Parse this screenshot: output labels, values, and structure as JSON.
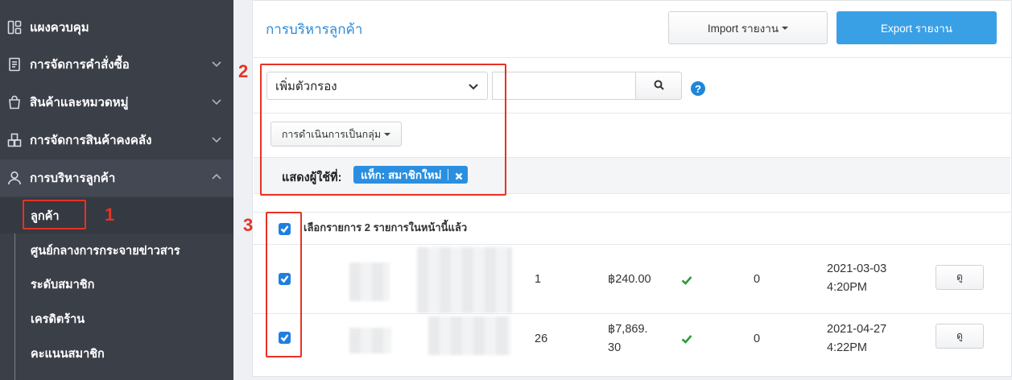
{
  "sidebar": {
    "items": [
      {
        "label": "แผงควบคุม",
        "icon": "dashboard-icon"
      },
      {
        "label": "การจัดการคำสั่งซื้อ",
        "icon": "order-list-icon"
      },
      {
        "label": "สินค้าและหมวดหมู่",
        "icon": "shopping-bag-icon"
      },
      {
        "label": "การจัดการสินค้าคงคลัง",
        "icon": "warehouse-icon"
      },
      {
        "label": "การบริหารลูกค้า",
        "icon": "user-icon"
      }
    ],
    "submenu": [
      {
        "label": "ลูกค้า"
      },
      {
        "label": "ศูนย์กลางการกระจายข่าวสาร"
      },
      {
        "label": "ระดับสมาชิก"
      },
      {
        "label": "เครดิตร้าน"
      },
      {
        "label": "คะแนนสมาชิก"
      }
    ]
  },
  "header": {
    "title": "การบริหารลูกค้า",
    "import_label": "Import รายงาน",
    "export_label": "Export รายงาน"
  },
  "filter": {
    "select_value": "เพิ่มตัวกรอง",
    "search_value": "",
    "bulk_label": "การดำเนินการเป็นกลุ่ม",
    "show_label": "แสดงผู้ใช้ที่:",
    "tag_label": "แท็ก: สมาชิกใหม่"
  },
  "table": {
    "select_all_text": "เลือกรายการ 2 รายการในหน้านี้แล้ว",
    "rows": [
      {
        "orders": "1",
        "amount": "฿240.00",
        "status_icon": "check-icon",
        "points": "0",
        "date": "2021-03-03",
        "time": "4:20PM",
        "action": "ดู"
      },
      {
        "orders": "26",
        "amount_line1": "฿7,869.",
        "amount_line2": "30",
        "status_icon": "check-icon",
        "points": "0",
        "date": "2021-04-27",
        "time": "4:22PM",
        "action": "ดู"
      }
    ]
  },
  "annotations": {
    "n1": "1",
    "n2": "2",
    "n3": "3",
    "color": "#e63324"
  },
  "colors": {
    "sidebar_bg": "#3b3f48",
    "accent": "#3aa0e6",
    "title_blue": "#2a8bd8",
    "check_green": "#2e9a3e"
  }
}
